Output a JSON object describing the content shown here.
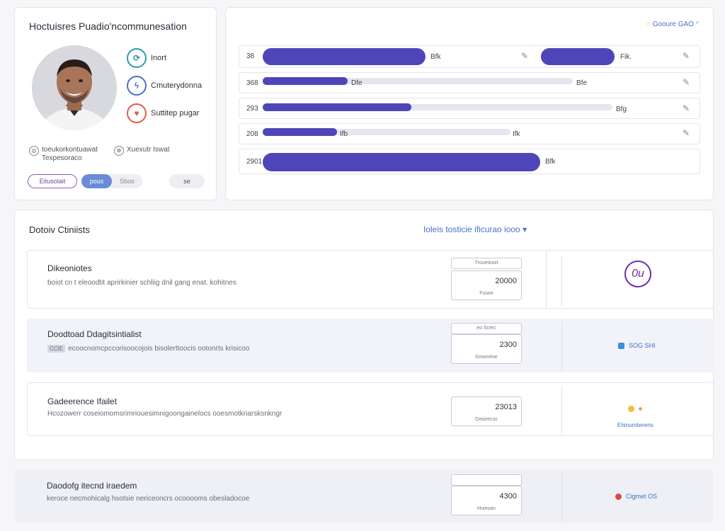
{
  "profile": {
    "title": "Hoctuisres Puadio'ncommunesation",
    "actions": [
      {
        "label": "Inort",
        "icon": "chart-icon",
        "color": "#2a9bb0",
        "glyph": "⟳"
      },
      {
        "label": "Cmuterydonna",
        "icon": "bolt-icon",
        "color": "#4a6fc8",
        "glyph": "ϟ"
      },
      {
        "label": "Suttitep pugar",
        "icon": "heart-icon",
        "color": "#e25a4a",
        "glyph": "♥"
      }
    ],
    "meta_left": "toeukorkontuawat\nTexpesoraco",
    "meta_right": "Xuexutr Iswat",
    "buttons": {
      "primary": "Eitusolait",
      "toggle_on": "pous",
      "toggle_off": "Sbos",
      "small": "se"
    }
  },
  "bars": {
    "top_right": "Gooure GAO ᐟ",
    "rows": [
      {
        "label": "38",
        "segments": [
          {
            "value": 0.38,
            "text": "Bfk"
          },
          {
            "value": 0.17,
            "text": "Fik."
          }
        ]
      },
      {
        "label": "368",
        "value": 0.19,
        "track": 0.68,
        "mid": "Dfe",
        "end": "Bfe"
      },
      {
        "label": "293",
        "value": 0.33,
        "track": 0.77,
        "end": "Bfg"
      },
      {
        "label": "208",
        "value": 0.17,
        "track": 0.55,
        "mid": "Ifb",
        "end": "Ifk"
      },
      {
        "label": "2901",
        "value": 0.62,
        "end": "Bfk"
      }
    ]
  },
  "clients": {
    "title": "Dotoiv Ctiniists",
    "filter": "Ioleis tosticie ificurao iooo ▾",
    "rows": [
      {
        "title": "Dikeoniotes",
        "subtitle": "boiot cn t eleoodtit aprirkinier schliig dnil gang enat. kohitnes",
        "tag": "",
        "field_top": "Trouetiooit",
        "value": "20000",
        "caption": "Fusoe",
        "status": "0u",
        "status_kind": "ring",
        "status_color": "#6b2fa8"
      },
      {
        "title": "Doodtoad Ddagitsintialist",
        "subtitle": "ecoocnomcpccorisoocojois bisolerttoocis ootonrts krisicoo",
        "tag": "CCIE",
        "field_top": "eo Scerc",
        "value": "2300",
        "caption": "Gowneloe",
        "status": "SOG SHI",
        "status_kind": "dot",
        "status_color": "#3a8fd8"
      },
      {
        "title": "Gadeerence Ifailet",
        "subtitle": "Hcozowerr coseiomomsrimriouesimnigoongainelocs ooesmotkriarsksnkngr",
        "tag": "",
        "field_top": "",
        "value": "23013",
        "caption": "Geiorecoc",
        "status": "Ehinumtwrens",
        "status_kind": "dot2",
        "status_color": "#f0c040"
      },
      {
        "title": "Daodofg itecnd iraedem",
        "subtitle": "keroce necmohicalg hsotsie nericeoncrs ocooooms obesladocoe",
        "tag": "",
        "field_top": "",
        "value": "4300",
        "caption": "Huieoan",
        "status": "Cigmet OS",
        "status_kind": "dot",
        "status_color": "#e04848"
      }
    ]
  }
}
